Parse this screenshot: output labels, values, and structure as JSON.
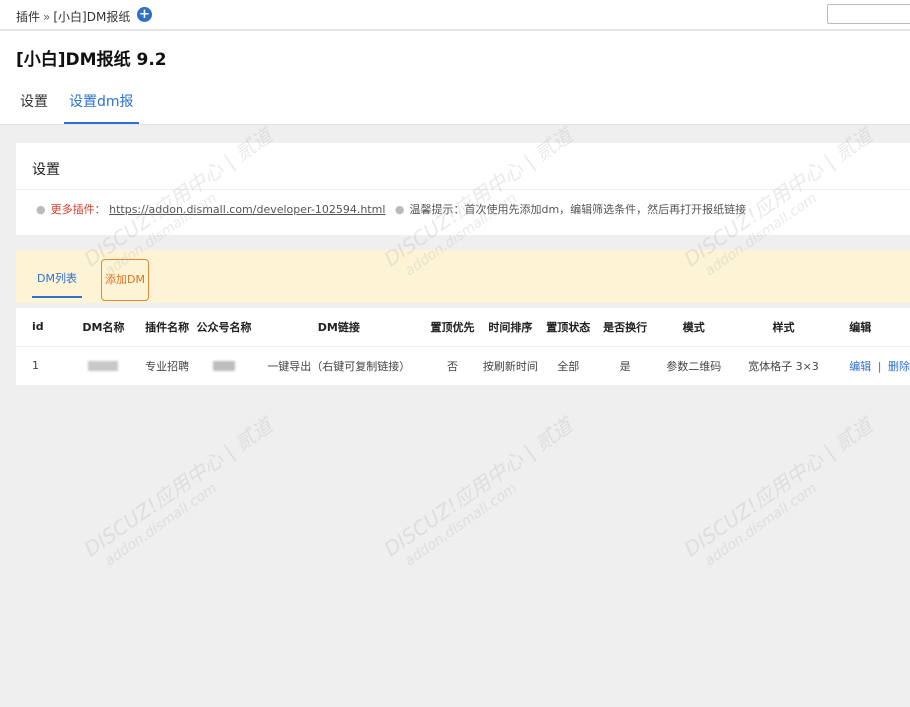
{
  "topbar": {
    "breadcrumb_root": "插件",
    "breadcrumb_sep": "»",
    "breadcrumb_current": "[小白]DM报纸",
    "add_icon": "plus-circle-icon"
  },
  "header": {
    "title": "[小白]DM报纸 9.2",
    "tabs": [
      {
        "label": "设置"
      },
      {
        "label": "设置dm报"
      }
    ]
  },
  "settings": {
    "title": "设置",
    "more_label": "更多插件：",
    "more_link": "https://addon.dismall.com/developer-102594.html",
    "hint": "温馨提示：首次使用先添加dm，编辑筛选条件，然后再打开报纸链接"
  },
  "dm": {
    "tabs": [
      {
        "label": "DM列表"
      },
      {
        "label": "添加DM"
      }
    ],
    "columns": [
      "id",
      "DM名称",
      "插件名称",
      "公众号名称",
      "DM链接",
      "置顶优先",
      "时间排序",
      "置顶状态",
      "是否换行",
      "模式",
      "样式",
      "编辑"
    ],
    "rows": [
      {
        "id": "1",
        "plugin": "专业招聘",
        "link": "一键导出（右键可复制链接）",
        "top_priority": "否",
        "sort": "按刷新时间",
        "top_status": "全部",
        "wrap": "是",
        "mode": "参数二维码",
        "style": "宽体格子 3×3",
        "edit": "编辑",
        "edit_sep": "|",
        "delete": "删除"
      }
    ]
  },
  "watermark": {
    "line1": "DISCUZ!应用中心 | 贰道",
    "line2": "addon.dismall.com"
  },
  "colors": {
    "accent": "#2e72d2",
    "warn": "#d43a2a",
    "add_button": "#e07020",
    "dm_bar_bg": "#fcf4d5"
  }
}
